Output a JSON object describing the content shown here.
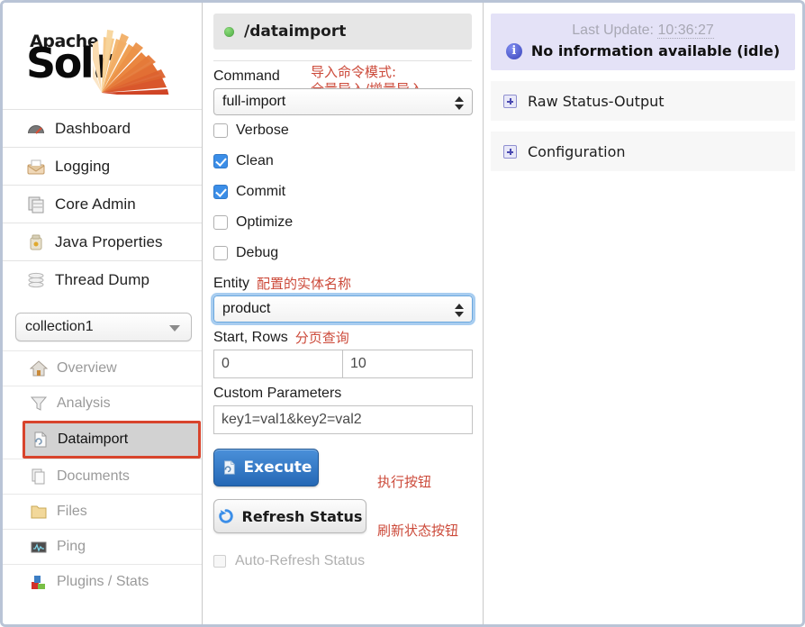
{
  "logo": {
    "apache": "Apache",
    "solr": "Solr"
  },
  "sidebar": {
    "main_items": [
      {
        "label": "Dashboard",
        "icon": "dashboard-icon"
      },
      {
        "label": "Logging",
        "icon": "logging-icon"
      },
      {
        "label": "Core Admin",
        "icon": "core-admin-icon"
      },
      {
        "label": "Java Properties",
        "icon": "java-properties-icon"
      },
      {
        "label": "Thread Dump",
        "icon": "thread-dump-icon"
      }
    ],
    "collection_selected": "collection1",
    "core_items": [
      {
        "label": "Overview",
        "icon": "home-icon",
        "active": false
      },
      {
        "label": "Analysis",
        "icon": "funnel-icon",
        "active": false
      },
      {
        "label": "Dataimport",
        "icon": "dataimport-icon",
        "active": true
      },
      {
        "label": "Documents",
        "icon": "documents-icon",
        "active": false
      },
      {
        "label": "Files",
        "icon": "folder-icon",
        "active": false
      },
      {
        "label": "Ping",
        "icon": "ping-icon",
        "active": false
      },
      {
        "label": "Plugins / Stats",
        "icon": "plugins-icon",
        "active": false
      }
    ]
  },
  "dataimport": {
    "handler_name": "/dataimport",
    "status_dot": "green",
    "command_label": "Command",
    "command_value": "full-import",
    "command_annotation_line1": "导入命令模式:",
    "command_annotation_line2": "全量导入/增量导入",
    "checkboxes": [
      {
        "label": "Verbose",
        "checked": false
      },
      {
        "label": "Clean",
        "checked": true
      },
      {
        "label": "Commit",
        "checked": true
      },
      {
        "label": "Optimize",
        "checked": false
      },
      {
        "label": "Debug",
        "checked": false
      }
    ],
    "entity_label": "Entity",
    "entity_value": "product",
    "entity_annotation": "配置的实体名称",
    "startrows_label": "Start, Rows",
    "startrows_annotation": "分页查询",
    "start_value": "0",
    "rows_value": "10",
    "custom_params_label": "Custom Parameters",
    "custom_params_placeholder": "key1=val1&key2=val2",
    "execute_label": "Execute",
    "execute_annotation": "执行按钮",
    "refresh_label": "Refresh Status",
    "refresh_annotation": "刷新状态按钮",
    "autorefresh_label": "Auto-Refresh Status"
  },
  "status_panel": {
    "last_update_label": "Last Update:",
    "last_update_time": "10:36:27",
    "status_message": "No information available (idle)",
    "info_glyph": "i",
    "accordions": [
      {
        "label": "Raw Status-Output"
      },
      {
        "label": "Configuration"
      }
    ]
  },
  "colors": {
    "accent_blue": "#2568b5",
    "annotation_red": "#cc4a3a",
    "highlight_red": "#d8442c",
    "status_green": "#4aa83f",
    "status_bg": "#e4e2f7"
  }
}
